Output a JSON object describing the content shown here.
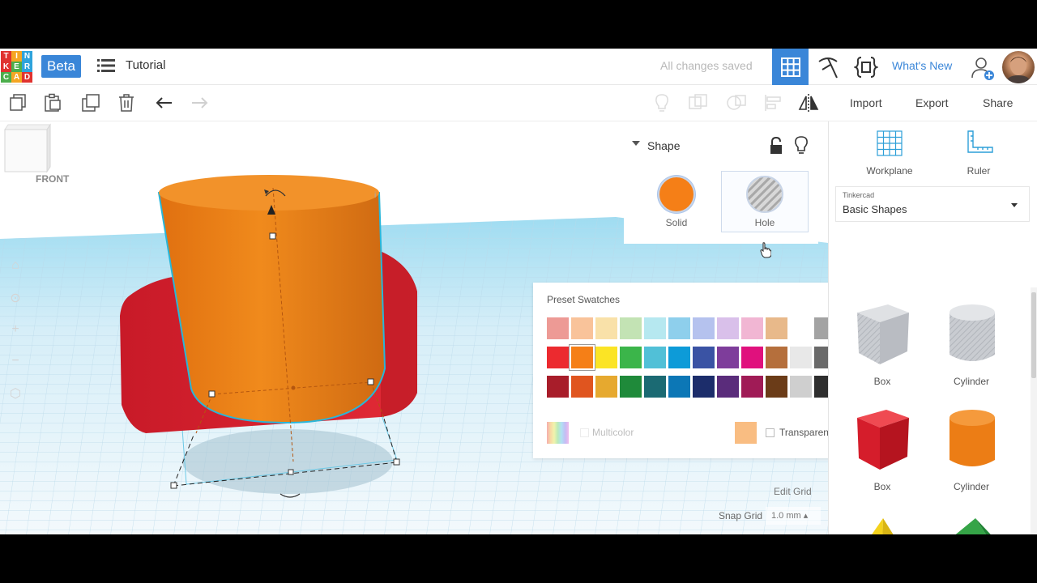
{
  "header": {
    "logo_letters": [
      "T",
      "I",
      "N",
      "K",
      "E",
      "R",
      "C",
      "A",
      "D"
    ],
    "logo_colors": [
      "#e0322f",
      "#f5a623",
      "#2ea3dc",
      "#e0322f",
      "#4cae4c",
      "#2ea3dc",
      "#4cae4c",
      "#f5a623",
      "#e0322f"
    ],
    "beta_label": "Beta",
    "design_title": "Tutorial",
    "save_status": "All changes saved",
    "whats_new_label": "What's New"
  },
  "toolbar": {
    "import_label": "Import",
    "export_label": "Export",
    "share_label": "Share"
  },
  "viewport": {
    "view_cube_label": "FRONT"
  },
  "shape_panel": {
    "title": "Shape",
    "solid_label": "Solid",
    "hole_label": "Hole",
    "solid_color": "#f57f17"
  },
  "color_popup": {
    "title": "Preset Swatches",
    "rows": [
      [
        "#ed9a95",
        "#f9c39a",
        "#f9e1a9",
        "#c3e3b4",
        "#b6e8f0",
        "#8ecfec",
        "#b5c2ee",
        "#d9c0ea",
        "#f1b6d3",
        "#e8b98a",
        "",
        "#a3a3a3"
      ],
      [
        "#ec2a2f",
        "#f57f17",
        "#fbe425",
        "#3bb54a",
        "#51c0d7",
        "#0d9bd8",
        "#3a53a4",
        "#7e3d9b",
        "#e0117d",
        "#b56f3c",
        "#e8e8e8",
        "#6a6a6a"
      ],
      [
        "#a81d2a",
        "#e0551f",
        "#e6a92f",
        "#1f8a3a",
        "#1b6a73",
        "#0c77b6",
        "#1c2d6b",
        "#5a2c7b",
        "#a01b56",
        "#6b3c18",
        "#cfcfcf",
        "#2e2e2e"
      ]
    ],
    "selected": "#f57f17",
    "multicolor_label": "Multicolor",
    "transparent_label": "Transparent"
  },
  "right_panel": {
    "workplane_label": "Workplane",
    "ruler_label": "Ruler",
    "library_source": "Tinkercad",
    "library_name": "Basic Shapes",
    "shapes": [
      {
        "label": "Box",
        "icon": "box-hole-icon"
      },
      {
        "label": "Cylinder",
        "icon": "cylinder-hole-icon"
      },
      {
        "label": "Box",
        "icon": "box-solid-icon"
      },
      {
        "label": "Cylinder",
        "icon": "cylinder-solid-icon"
      },
      {
        "label": "",
        "icon": "pyramid-icon"
      },
      {
        "label": "",
        "icon": "roof-icon"
      }
    ]
  },
  "grid_controls": {
    "edit_grid_label": "Edit Grid",
    "snap_grid_label": "Snap Grid",
    "snap_value": "1.0 mm"
  }
}
